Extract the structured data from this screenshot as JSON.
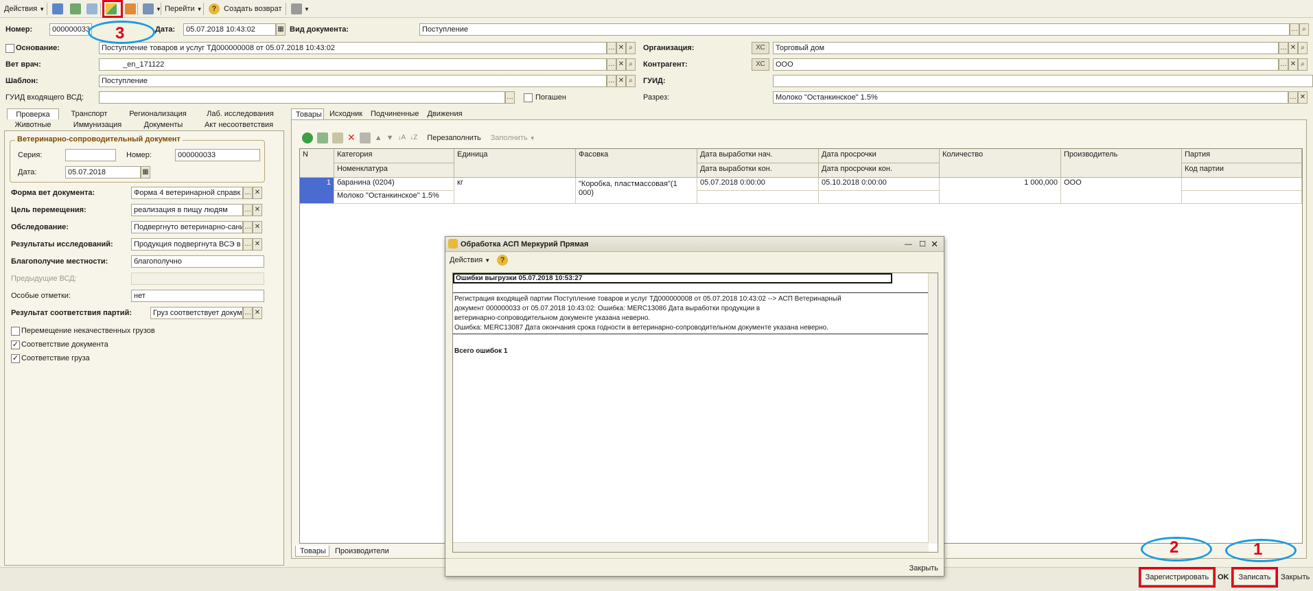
{
  "toolbar": {
    "actions": "Действия",
    "goto": "Перейти",
    "help": "?",
    "create_return": "Создать возврат"
  },
  "header": {
    "number_label": "Номер:",
    "number_value": "000000033",
    "date_label": "Дата:",
    "date_value": "05.07.2018 10:43:02",
    "doc_type_label": "Вид документа:",
    "doc_type_value": "Поступление",
    "basis_label": "Основание:",
    "basis_value": "Поступление товаров и услуг ТД000000008 от 05.07.2018 10:43:02",
    "org_label": "Организация:",
    "org_value": "Торговый дом",
    "vet_label": "Вет врач:",
    "vet_value": "_en_171122",
    "contractor_label": "Контрагент:",
    "contractor_value": "ООО",
    "template_label": "Шаблон:",
    "template_value": "Поступление",
    "guid_label": "ГУИД:",
    "guid_value": "",
    "guid_in_label": "ГУИД входящего ВСД:",
    "guid_in_value": "",
    "repaid_label": "Погашен",
    "section_label": "Разрез:",
    "section_value": "Молоко \"Останкинское\" 1.5%",
    "xs": "ХС"
  },
  "left_tabs": [
    "Проверка",
    "Транспорт",
    "Регионализация",
    "Лаб. исследования",
    "Животные",
    "Иммунизация",
    "Документы",
    "Акт несоответствия"
  ],
  "vsd": {
    "group_title": "Ветеринарно-сопроводительный документ",
    "series_label": "Серия:",
    "series_value": "",
    "number_label": "Номер:",
    "number_value": "000000033",
    "date_label": "Дата:",
    "date_value": "05.07.2018"
  },
  "left_fields": [
    {
      "label": "Форма вет документа:",
      "value": "Форма 4 ветеринарной справк"
    },
    {
      "label": "Цель перемещения:",
      "value": "реализация в пищу людям"
    },
    {
      "label": "Обследование:",
      "value": "Подвергнуто ветеринарно-сани"
    },
    {
      "label": "Результаты исследований:",
      "value": "Продукция подвергнута ВСЭ в"
    },
    {
      "label": "Благополучие местности:",
      "value": "благополучно"
    },
    {
      "label": "Предыдущие ВСД:",
      "value": ""
    },
    {
      "label": "Особые отметки:",
      "value": "нет"
    },
    {
      "label": "Результат соответствия партий:",
      "value": "Груз соответствует докум"
    }
  ],
  "left_checks": [
    {
      "label": "Перемещение некачественных грузов",
      "checked": false
    },
    {
      "label": "Соответствие документа",
      "checked": true
    },
    {
      "label": "Соответствие груза",
      "checked": true
    }
  ],
  "right_tabs": [
    "Товары",
    "Исходник",
    "Подчиненные",
    "Движения"
  ],
  "grid_toolbar": {
    "refill": "Перезаполнить",
    "fill": "Заполнить"
  },
  "grid": {
    "headers_top": [
      "N",
      "Категория",
      "Единица",
      "Фасовка",
      "Дата выработки нач.",
      "Дата просрочки",
      "Количество",
      "Производитель",
      "Партия"
    ],
    "headers_bottom": [
      "Номенклатура",
      "Дата выработки кон.",
      "Дата просрочки кон.",
      "Код партии"
    ],
    "row": {
      "n": "1",
      "category": "баранина (0204)",
      "nomenclature": "Молоко \"Останкинское\" 1.5%",
      "unit": "кг",
      "packing": "\"Коробка, пластмассовая\"(1 000)",
      "prod_date": "05.07.2018 0:00:00",
      "exp_date": "05.10.2018 0:00:00",
      "qty": "1 000,000",
      "producer": "ООО"
    }
  },
  "bottom_tabs": [
    "Товары",
    "Производители"
  ],
  "footer": {
    "register": "Зарегистрировать",
    "ok": "OK",
    "save": "Записать",
    "close": "Закрыть"
  },
  "annotations": {
    "n1": "1",
    "n2": "2",
    "n3": "3"
  },
  "dialog": {
    "title": "Обработка  АСП Меркурий Прямая",
    "actions": "Действия",
    "heading": "Ошибки выгрузки 05.07.2018 10:53:27",
    "lines": [
      "Регистрация входящей партии Поступление товаров и услуг ТД000000008 от 05.07.2018 10:43:02 --> АСП Ветеринарный",
      "документ 000000033 от 05.07.2018 10:43:02: Ошибка: MERC13086 Дата выработки продукции в",
      "ветеринарно-сопроводительном документе указана неверно.",
      "Ошибка: MERC13087 Дата окончания срока годности в ветеринарно-сопроводительном документе указана неверно."
    ],
    "total": "Всего ошибок 1",
    "close": "Закрыть"
  },
  "colors": {
    "highlight": "#e0001b",
    "ellipse": "#1a9be0",
    "selected_row": "#4a6bd0"
  }
}
